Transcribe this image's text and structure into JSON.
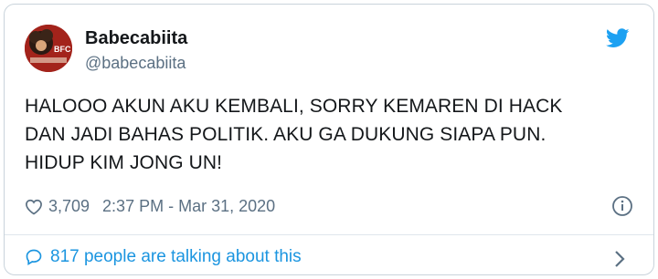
{
  "user": {
    "display_name": "Babecabiita",
    "handle": "@babecabiita",
    "avatar_icon": "profile-avatar",
    "avatar_text": "BFC"
  },
  "tweet": {
    "lines": [
      "HALOOO AKUN AKU KEMBALI, SORRY KEMAREN DI HACK",
      "DAN JADI BAHAS POLITIK. AKU GA DUKUNG SIAPA PUN.",
      "HIDUP KIM JONG UN!"
    ]
  },
  "meta": {
    "likes": "3,709",
    "timestamp": "2:37 PM - Mar 31, 2020"
  },
  "footer": {
    "talking": "817 people are talking about this"
  },
  "icons": {
    "brand": "twitter-bird-icon",
    "like": "heart-icon",
    "info": "info-icon",
    "reply": "speech-bubble-icon",
    "more": "chevron-right-icon"
  },
  "colors": {
    "accent": "#1da1f2",
    "link": "#1b95e0",
    "secondary_text": "#5b7083",
    "border": "#c9d3db"
  }
}
